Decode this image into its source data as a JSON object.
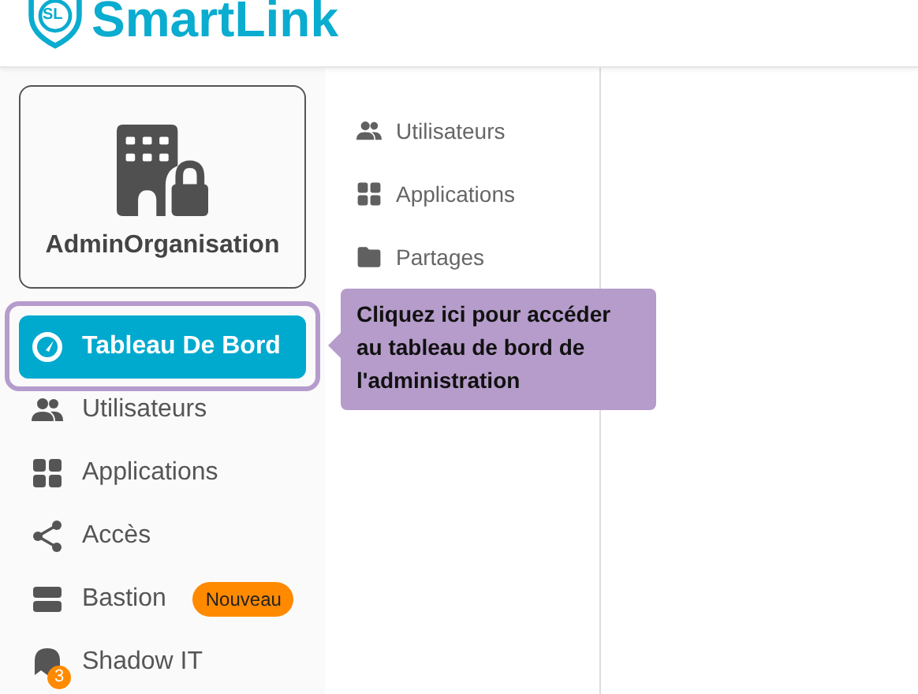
{
  "brand": {
    "name": "SmartLink",
    "monogram": "SL"
  },
  "org": {
    "name": "AdminOrganisation"
  },
  "nav": [
    {
      "label": "Tableau De Bord",
      "kind": "gauge",
      "selected": true,
      "highlighted": true
    },
    {
      "label": "Utilisateurs",
      "kind": "users",
      "selected": false,
      "highlighted": false
    },
    {
      "label": "Applications",
      "kind": "grid",
      "selected": false,
      "highlighted": false
    },
    {
      "label": "Accès",
      "kind": "share",
      "selected": false,
      "highlighted": false
    },
    {
      "label": "Bastion",
      "kind": "server",
      "selected": false,
      "highlighted": false,
      "badge": "Nouveau"
    },
    {
      "label": "Shadow IT",
      "kind": "ghost",
      "selected": false,
      "highlighted": false,
      "count": "3"
    }
  ],
  "tooltip": {
    "text": "Cliquez ici pour accéder au tableau de bord de l'administration"
  },
  "submenu": [
    {
      "label": "Utilisateurs",
      "kind": "users"
    },
    {
      "label": "Applications",
      "kind": "grid"
    },
    {
      "label": "Partages",
      "kind": "folder"
    }
  ]
}
